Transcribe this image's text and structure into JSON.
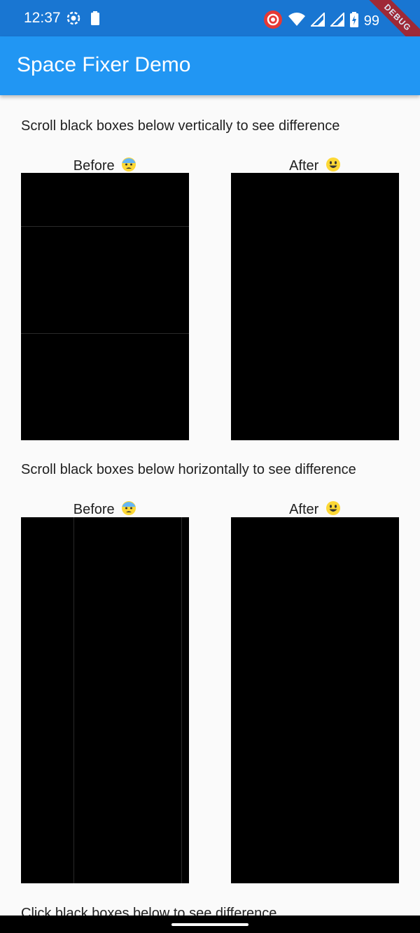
{
  "status_bar": {
    "time": "12:37",
    "battery_text": "99",
    "background": "#1976d2",
    "icons": [
      "settings-dot-icon",
      "battery-small-icon",
      "record-icon",
      "wifi-icon",
      "signal-icon",
      "signal-icon",
      "battery-charging-icon"
    ]
  },
  "debug_banner": {
    "label": "DEBUG",
    "color": "#b71c1c"
  },
  "app_bar": {
    "title": "Space Fixer Demo",
    "background": "#2196f3"
  },
  "sections": [
    {
      "description": "Scroll black boxes below vertically to see difference",
      "before_label": "Before",
      "before_emoji": "anxious-face-icon",
      "after_label": "After",
      "after_emoji": "smiley-face-icon"
    },
    {
      "description": "Scroll black boxes below horizontally to see difference",
      "before_label": "Before",
      "before_emoji": "anxious-face-icon",
      "after_label": "After",
      "after_emoji": "smiley-face-icon"
    },
    {
      "description": "Click black boxes below to see difference"
    }
  ],
  "box_color": "#000000"
}
